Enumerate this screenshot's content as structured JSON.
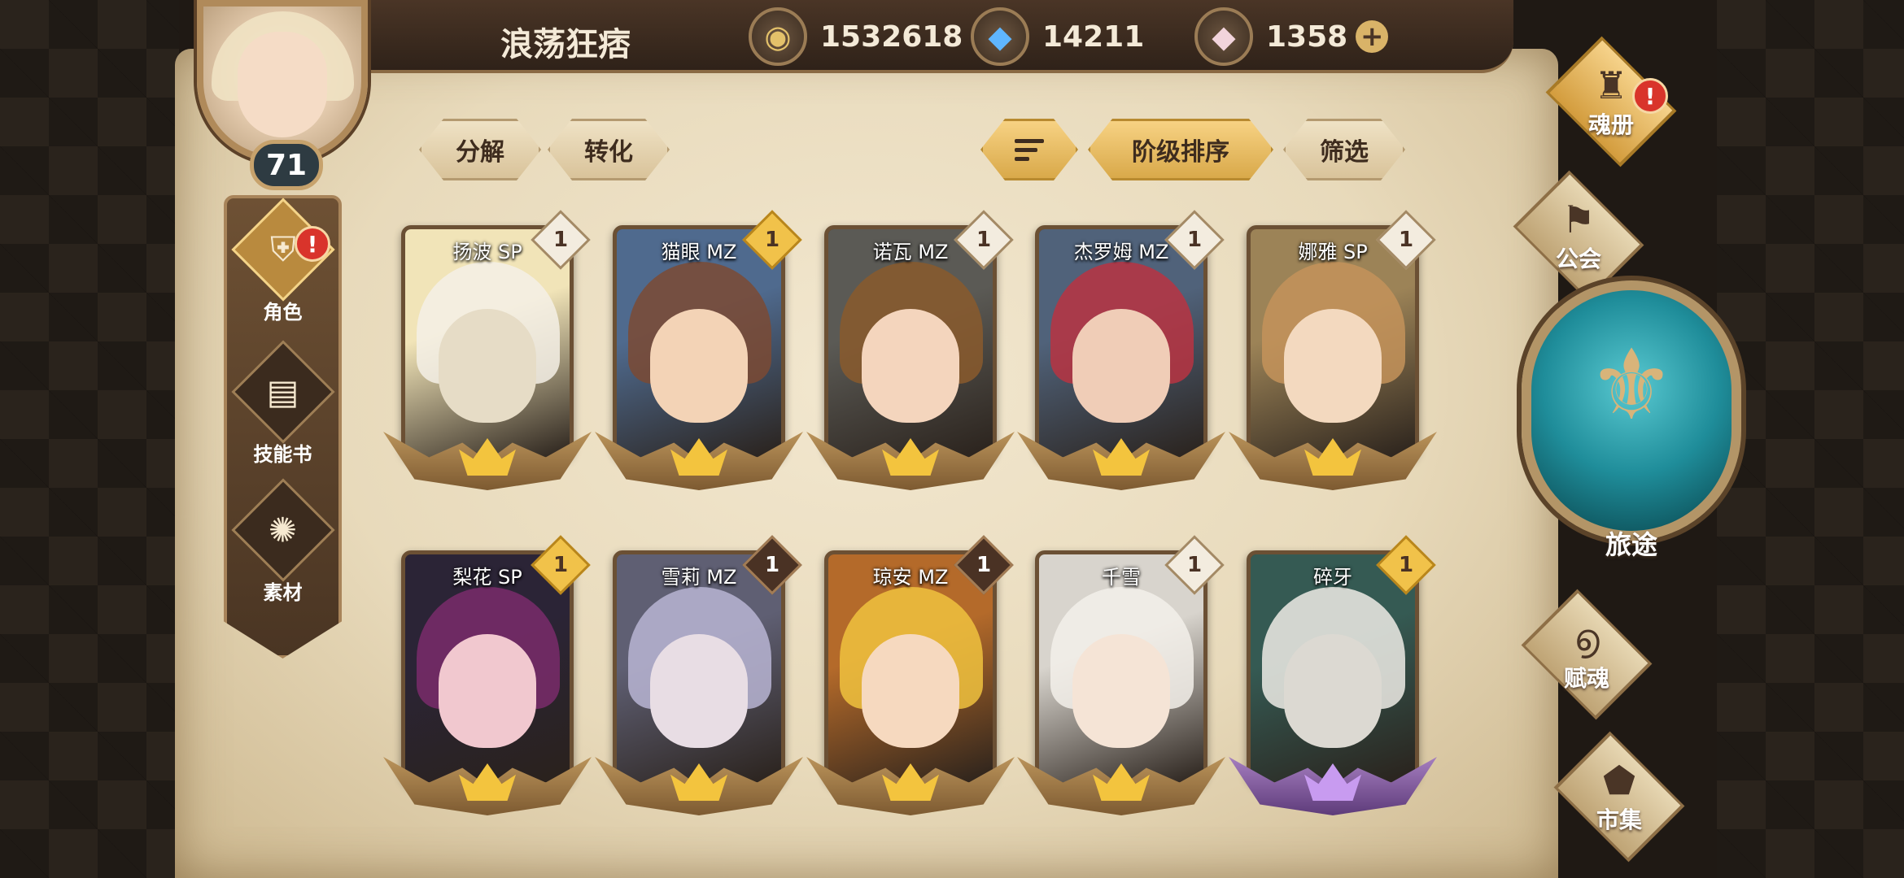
{
  "header": {
    "player_name": "浪荡狂痞",
    "gold": "1532618",
    "crystal": "14211",
    "gem": "1358",
    "gem_add": "+"
  },
  "avatar": {
    "level": "71"
  },
  "left_menu": [
    {
      "label": "角色",
      "icon": "helmet-icon",
      "alert": "!"
    },
    {
      "label": "技能书",
      "icon": "book-icon"
    },
    {
      "label": "素材",
      "icon": "material-icon"
    }
  ],
  "toolbar": {
    "decompose": "分解",
    "convert": "转化",
    "sort_by_tier": "阶级排序",
    "filter": "筛选"
  },
  "cards": [
    {
      "name": "扬波 SP",
      "count": "1",
      "badge": "light"
    },
    {
      "name": "猫眼 MZ",
      "count": "1",
      "badge": "gold"
    },
    {
      "name": "诺瓦 MZ",
      "count": "1",
      "badge": "light"
    },
    {
      "name": "杰罗姆 MZ",
      "count": "1",
      "badge": "light"
    },
    {
      "name": "娜雅 SP",
      "count": "1",
      "badge": "light"
    },
    {
      "name": "梨花 SP",
      "count": "1",
      "badge": "gold"
    },
    {
      "name": "雪莉 MZ",
      "count": "1",
      "badge": "dark"
    },
    {
      "name": "琼安 MZ",
      "count": "1",
      "badge": "dark"
    },
    {
      "name": "千雪",
      "count": "1",
      "badge": "light"
    },
    {
      "name": "碎牙",
      "count": "1",
      "badge": "gold"
    }
  ],
  "right_nav": {
    "soul_book": "魂册",
    "soul_book_alert": "!",
    "guild": "公会",
    "journey": "旅途",
    "endow": "赋魂",
    "market": "市集"
  },
  "colors": {
    "accent_gold": "#f3c43e",
    "alert_red": "#d9342b",
    "journey_teal": "#1f8d9a"
  }
}
